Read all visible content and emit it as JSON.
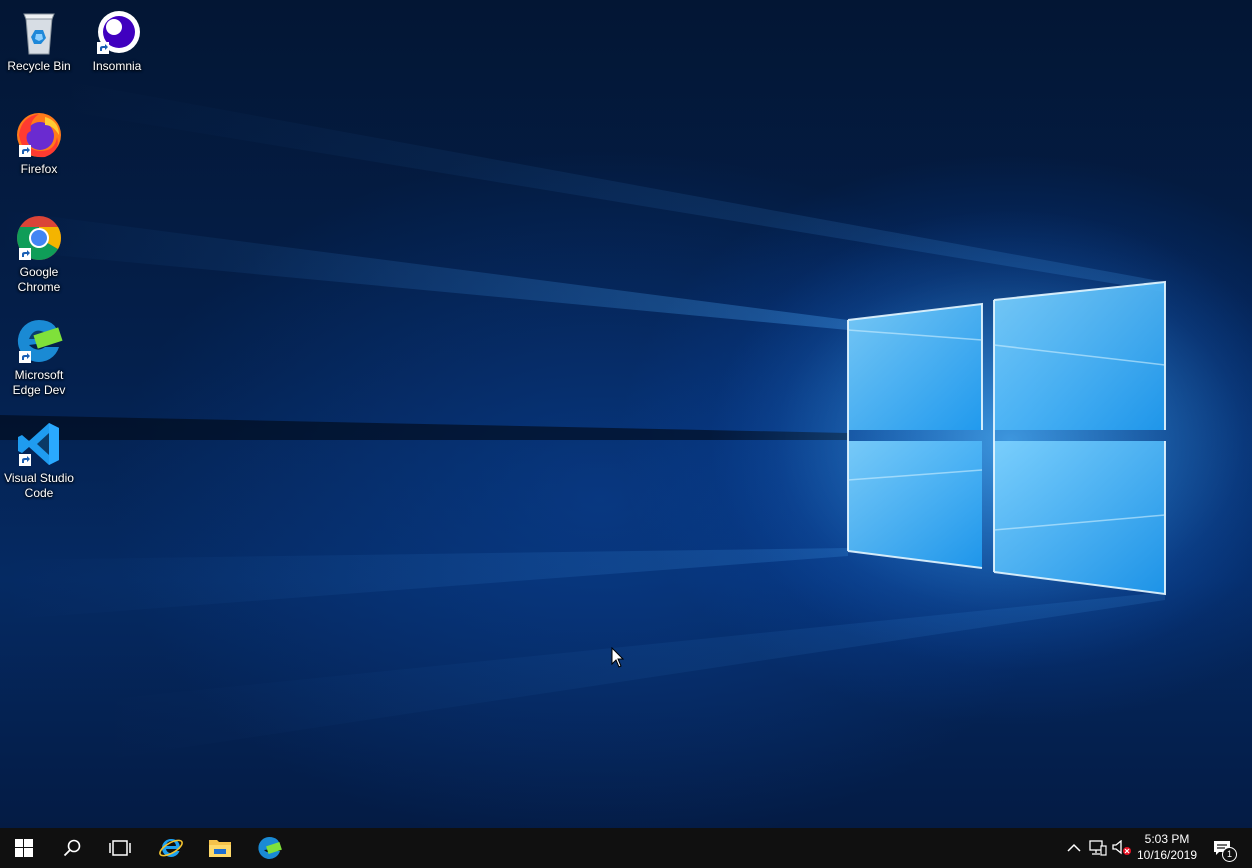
{
  "desktop": {
    "icons": [
      {
        "label": "Recycle Bin"
      },
      {
        "label": "Insomnia"
      },
      {
        "label": "Firefox"
      },
      {
        "label": "Google Chrome"
      },
      {
        "label": "Microsoft Edge Dev"
      },
      {
        "label": "Visual Studio Code"
      }
    ]
  },
  "taskbar": {
    "pinned": [
      "start-icon",
      "search-icon",
      "task-view-icon",
      "internet-explorer-icon",
      "file-explorer-icon",
      "edge-dev-icon"
    ],
    "tray": {
      "time": "5:03 PM",
      "date": "10/16/2019",
      "notification_count": "1"
    }
  },
  "colors": {
    "taskbar": "#101010",
    "accent": "#0a78d7"
  }
}
